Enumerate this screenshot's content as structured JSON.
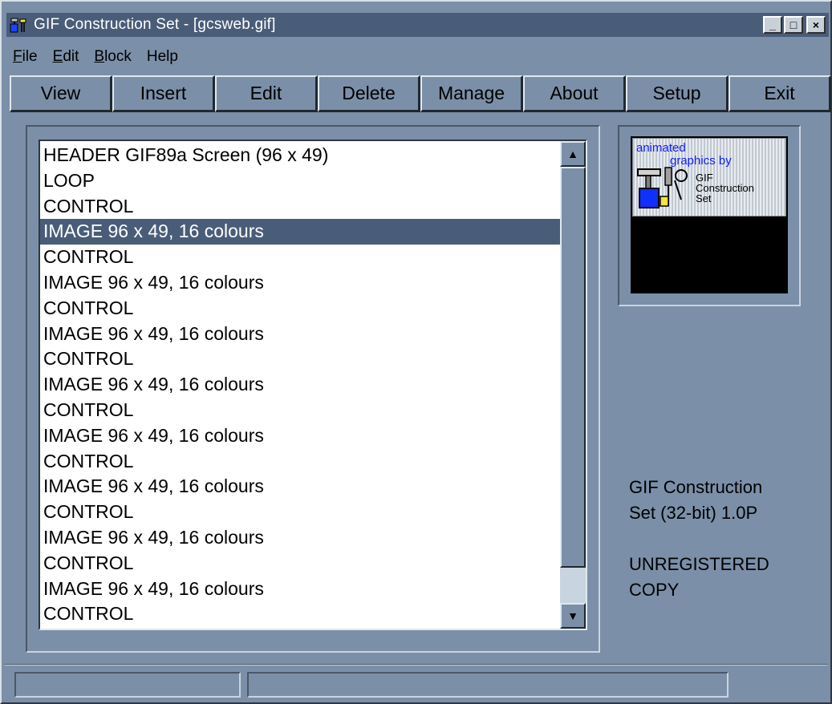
{
  "window": {
    "title": "GIF Construction Set - [gcsweb.gif]",
    "buttons": {
      "minimize": "_",
      "maximize": "□",
      "close": "×"
    }
  },
  "menu": [
    {
      "label": "File",
      "hotkey": "F",
      "rest": "ile"
    },
    {
      "label": "Edit",
      "hotkey": "E",
      "rest": "dit"
    },
    {
      "label": "Block",
      "hotkey": "B",
      "rest": "lock"
    },
    {
      "label": "Help",
      "hotkey": "",
      "rest": "Help"
    }
  ],
  "toolbar": {
    "view": "View",
    "insert": "Insert",
    "edit": "Edit",
    "delete": "Delete",
    "manage": "Manage",
    "about": "About",
    "setup": "Setup",
    "exit": "Exit"
  },
  "blocks": [
    "HEADER GIF89a Screen (96 x 49)",
    "LOOP",
    "CONTROL",
    "IMAGE 96 x 49, 16 colours",
    "CONTROL",
    "IMAGE 96 x 49, 16 colours",
    "CONTROL",
    "IMAGE 96 x 49, 16 colours",
    "CONTROL",
    "IMAGE 96 x 49, 16 colours",
    "CONTROL",
    "IMAGE 96 x 49, 16 colours",
    "CONTROL",
    "IMAGE 96 x 49, 16 colours",
    "CONTROL",
    "IMAGE 96 x 49, 16 colours",
    "CONTROL",
    "IMAGE 96 x 49, 16 colours",
    "CONTROL"
  ],
  "selected_index": 3,
  "preview": {
    "line1": "animated",
    "line2": "graphics by",
    "line3": "GIF",
    "line4": "Construction",
    "line5": "Set"
  },
  "info": {
    "product_line1": "GIF Construction",
    "product_line2": "Set (32-bit) 1.0P",
    "reg_line1": "UNREGISTERED",
    "reg_line2": "COPY"
  },
  "status": {
    "pane1": "",
    "pane2": ""
  },
  "scrollbar": {
    "up_arrow": "▲",
    "down_arrow": "▼"
  },
  "colors": {
    "titlebar": "#4a5d78",
    "face": "#7b8fa8",
    "selection": "#4a5d78",
    "preview_text": "#1020ff"
  }
}
